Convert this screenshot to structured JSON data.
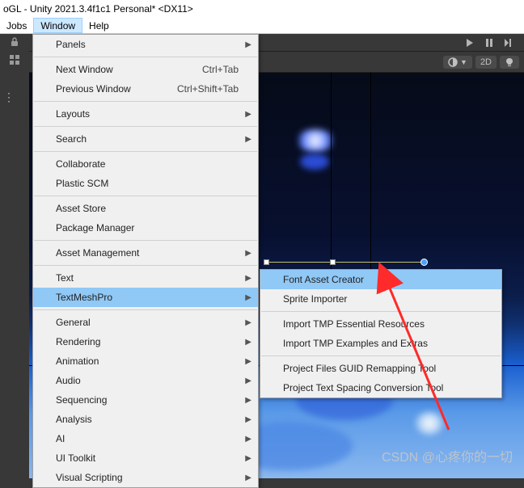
{
  "title": "oGL - Unity 2021.3.4f1c1 Personal* <DX11>",
  "menubar": {
    "jobs": "Jobs",
    "window": "Window",
    "help": "Help"
  },
  "second_toolbar": {
    "mode2d": "2D"
  },
  "window_menu": {
    "items": [
      {
        "label": "Panels",
        "sub": true
      },
      {
        "sep": true
      },
      {
        "label": "Next Window",
        "shortcut": "Ctrl+Tab"
      },
      {
        "label": "Previous Window",
        "shortcut": "Ctrl+Shift+Tab"
      },
      {
        "sep": true
      },
      {
        "label": "Layouts",
        "sub": true
      },
      {
        "sep": true
      },
      {
        "label": "Search",
        "sub": true
      },
      {
        "sep": true
      },
      {
        "label": "Collaborate"
      },
      {
        "label": "Plastic SCM"
      },
      {
        "sep": true
      },
      {
        "label": "Asset Store"
      },
      {
        "label": "Package Manager"
      },
      {
        "sep": true
      },
      {
        "label": "Asset Management",
        "sub": true
      },
      {
        "sep": true
      },
      {
        "label": "Text",
        "sub": true
      },
      {
        "label": "TextMeshPro",
        "sub": true,
        "hover": true
      },
      {
        "sep": true
      },
      {
        "label": "General",
        "sub": true
      },
      {
        "label": "Rendering",
        "sub": true
      },
      {
        "label": "Animation",
        "sub": true
      },
      {
        "label": "Audio",
        "sub": true
      },
      {
        "label": "Sequencing",
        "sub": true
      },
      {
        "label": "Analysis",
        "sub": true
      },
      {
        "label": "AI",
        "sub": true
      },
      {
        "label": "UI Toolkit",
        "sub": true
      },
      {
        "label": "Visual Scripting",
        "sub": true
      }
    ]
  },
  "tmp_submenu": {
    "items": [
      {
        "label": "Font Asset Creator",
        "hover": true
      },
      {
        "label": "Sprite Importer"
      },
      {
        "sep": true
      },
      {
        "label": "Import TMP Essential Resources"
      },
      {
        "label": "Import TMP Examples and Extras"
      },
      {
        "sep": true
      },
      {
        "label": "Project Files GUID Remapping Tool"
      },
      {
        "label": "Project Text Spacing Conversion Tool"
      }
    ]
  },
  "watermark": "CSDN @心疼你的一切"
}
